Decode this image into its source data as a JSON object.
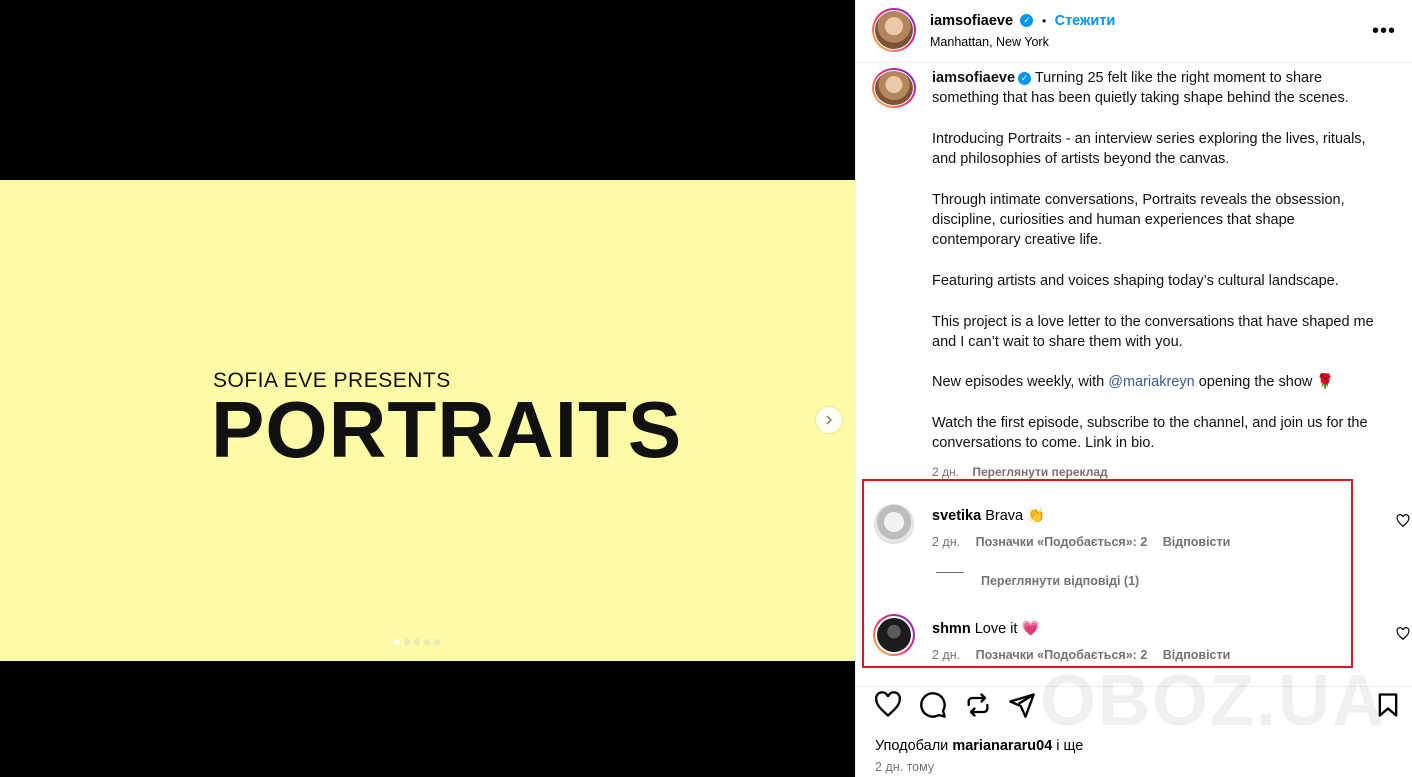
{
  "slide": {
    "presents": "SOFIA EVE PRESENTS",
    "title": "PORTRAITS",
    "bg_color": "#fdfba5",
    "dot_count": 5,
    "active_dot": 0
  },
  "header": {
    "username": "iamsofiaeve",
    "separator": "•",
    "follow_label": "Стежити",
    "location": "Manhattan, New York",
    "more_label": "•••"
  },
  "caption": {
    "username": "iamsofiaeve",
    "p1": "Turning 25 felt like the right moment to share something that has been quietly taking shape behind the scenes.",
    "p2": "Introducing Portraits - an interview series exploring the lives, rituals, and philosophies of artists beyond the canvas.",
    "p3": "Through intimate conversations, Portraits reveals the obsession, discipline, curiosities and human experiences that shape contemporary creative life.",
    "p4": "Featuring artists and voices shaping today’s cultural landscape.",
    "p5": "This project is a love letter to the conversations that have shaped me and I can’t wait to share them with you.",
    "p6_before": "New episodes weekly, with ",
    "p6_mention": "@mariakreyn",
    "p6_after": " opening the show 🌹",
    "p7": "Watch the first episode, subscribe to the channel, and join us for the conversations to come. Link in bio.",
    "time": "2 дн.",
    "translate": "Переглянути переклад"
  },
  "comments": [
    {
      "username": "svetika",
      "text": "Brava 👏",
      "time": "2 дн.",
      "likes": "Позначки «Подобається»: 2",
      "reply": "Відповісти"
    },
    {
      "username": "shmn",
      "text": "Love it 💗",
      "time": "2 дн.",
      "likes": "Позначки «Подобається»: 2",
      "reply": "Відповісти"
    }
  ],
  "view_replies": "Переглянути відповіді (1)",
  "footer": {
    "liked_by_prefix": "Уподобали ",
    "liked_by_user": "marianararu04",
    "liked_by_suffix": " і ще",
    "date": "2 дн. тому"
  },
  "watermark": "OBOZ.UA",
  "colors": {
    "accent": "#0095f6",
    "highlight": "#d71920",
    "mention": "#385898"
  }
}
